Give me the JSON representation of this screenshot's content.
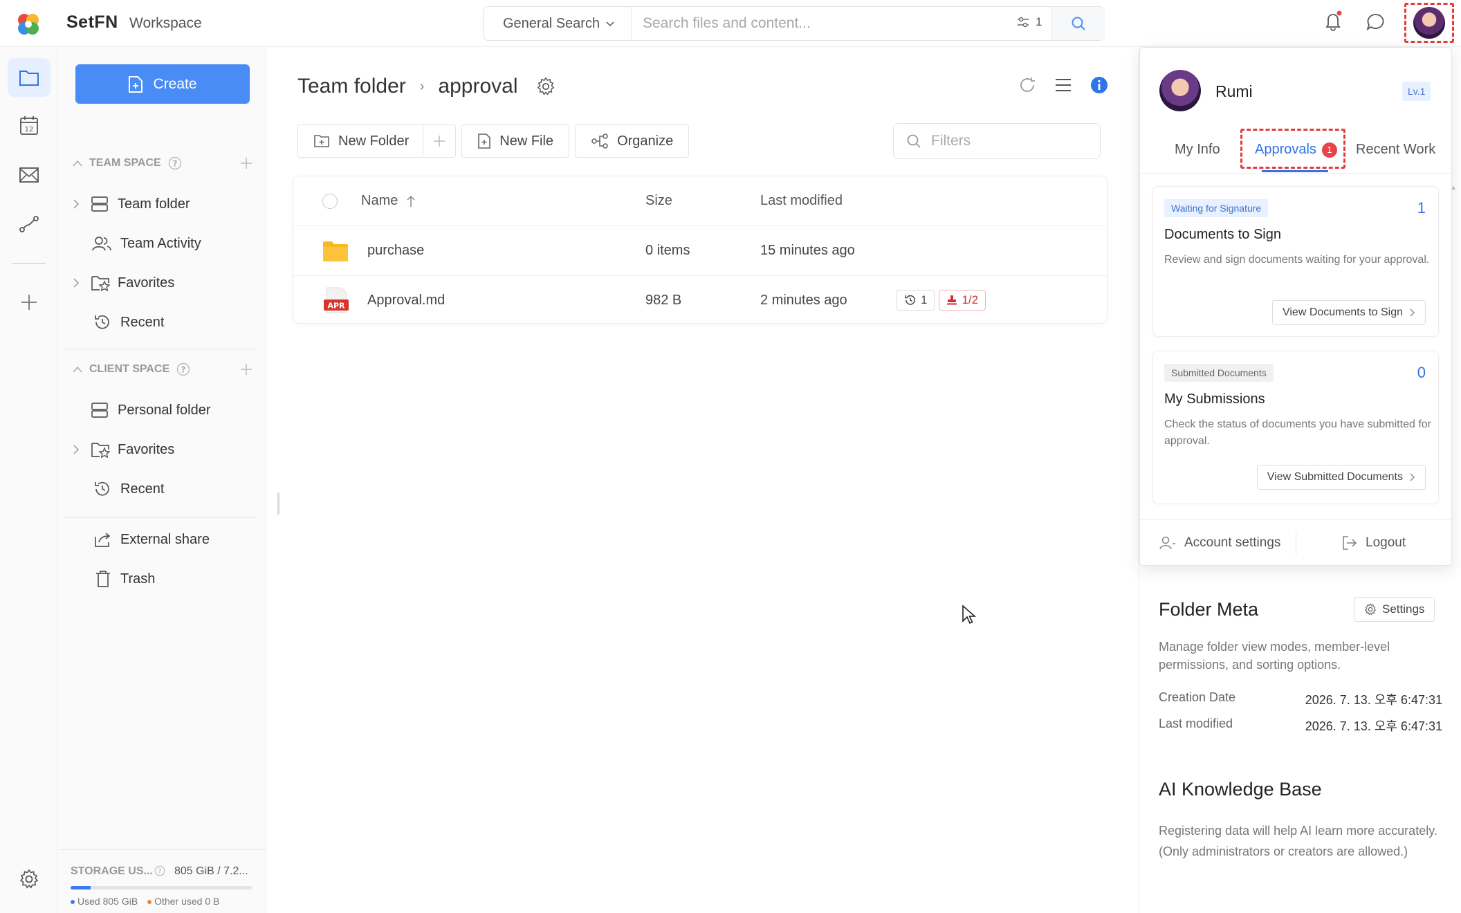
{
  "app": {
    "brand": "SetFN",
    "workspace": "Workspace"
  },
  "search": {
    "mode": "General Search",
    "placeholder": "Search files and content...",
    "filter_count": "1"
  },
  "sidebar": {
    "create_label": "Create",
    "team_space": {
      "title": "TEAM SPACE",
      "items": [
        {
          "label": "Team folder"
        },
        {
          "label": "Team Activity"
        },
        {
          "label": "Favorites"
        },
        {
          "label": "Recent"
        }
      ]
    },
    "client_space": {
      "title": "CLIENT SPACE",
      "items": [
        {
          "label": "Personal folder"
        },
        {
          "label": "Favorites"
        },
        {
          "label": "Recent"
        }
      ]
    },
    "extra": [
      {
        "label": "External share"
      },
      {
        "label": "Trash"
      }
    ],
    "storage": {
      "title": "STORAGE US...",
      "value": "805 GiB / 7.2...",
      "used_fraction": 0.11,
      "used_label": "Used 805 GiB",
      "other_label": "Other used 0 B",
      "used_color": "#3b7cf0",
      "other_color": "#f0862e"
    }
  },
  "main": {
    "breadcrumb": [
      "Team folder",
      "approval"
    ],
    "toolbar": {
      "new_folder": "New Folder",
      "new_file": "New File",
      "organize": "Organize"
    },
    "filters_placeholder": "Filters",
    "table": {
      "headers": {
        "name": "Name",
        "size": "Size",
        "modified": "Last modified"
      },
      "rows": [
        {
          "name": "purchase",
          "size": "0 items",
          "modified": "15 minutes ago",
          "icon": "folder-icon"
        },
        {
          "name": "Approval.md",
          "size": "982 B",
          "modified": "2 minutes ago",
          "icon": "apr-file-icon",
          "file_tag": "APR",
          "version": "1",
          "approval": "1/2"
        }
      ]
    }
  },
  "profile": {
    "name": "Rumi",
    "level": "Lv.1",
    "tabs": [
      {
        "label": "My Info"
      },
      {
        "label": "Approvals",
        "badge": "1"
      },
      {
        "label": "Recent Work"
      }
    ],
    "cards": [
      {
        "tag": "Waiting for Signature",
        "count": "1",
        "title": "Documents to Sign",
        "desc": "Review and sign documents waiting for your approval.",
        "button": "View Documents to Sign"
      },
      {
        "tag": "Submitted Documents",
        "count": "0",
        "title": "My Submissions",
        "desc": "Check the status of documents you have submitted for approval.",
        "button": "View Submitted Documents"
      }
    ],
    "account_settings": "Account settings",
    "logout": "Logout"
  },
  "folder_meta": {
    "title": "Folder Meta",
    "settings_label": "Settings",
    "desc": "Manage folder view modes, member-level permissions, and sorting options.",
    "creation_label": "Creation Date",
    "creation_value": "2026. 7. 13. 오후 6:47:31",
    "modified_label": "Last modified",
    "modified_value": "2026. 7. 13. 오후 6:47:31"
  },
  "ai_kb": {
    "title": "AI Knowledge Base",
    "desc": "Registering data will help AI learn more accurately. (Only administrators or creators are allowed.)"
  }
}
